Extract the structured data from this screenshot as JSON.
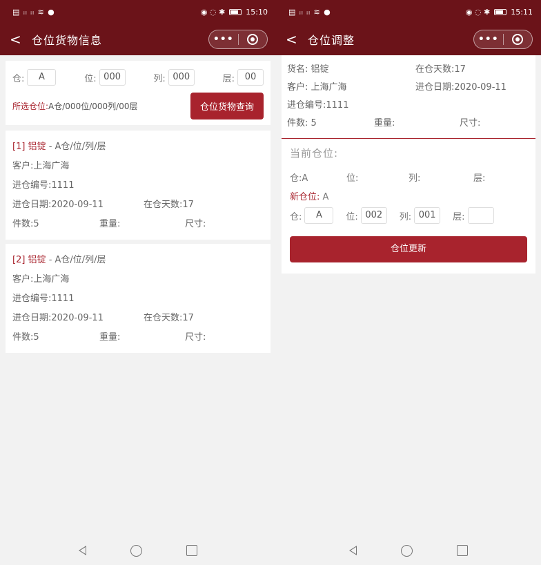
{
  "left": {
    "status": {
      "signal": "▤ ᵢₗ ᵢₗ ≋ ●",
      "right_icons": "◉ ◌ ✱",
      "battery": "78",
      "time": "15:10"
    },
    "nav": {
      "back": "<",
      "title": "仓位货物信息",
      "more": "•••"
    },
    "search": {
      "cang_label": "仓:",
      "cang_value": "A",
      "wei_label": "位:",
      "wei_value": "000",
      "lie_label": "列:",
      "lie_value": "000",
      "ceng_label": "层:",
      "ceng_value": "00"
    },
    "selected": {
      "label": "所选仓位:",
      "value": "A仓/000位/000列/00层"
    },
    "query_button": "仓位货物查询",
    "cards": [
      {
        "index": "[1] 铝锭",
        "loc": " - A仓/位/列/层",
        "customer": "客户:上海广海",
        "entry_no": "进仓编号:1111",
        "entry_date": "进仓日期:2020-09-11",
        "days": "在仓天数:17",
        "count": "件数:5",
        "weight": "重量:",
        "size": "尺寸:"
      },
      {
        "index": "[2] 铝锭",
        "loc": " - A仓/位/列/层",
        "customer": "客户:上海广海",
        "entry_no": "进仓编号:1111",
        "entry_date": "进仓日期:2020-09-11",
        "days": "在仓天数:17",
        "count": "件数:5",
        "weight": "重量:",
        "size": "尺寸:"
      }
    ]
  },
  "right": {
    "status": {
      "signal": "▤ ᵢₗ ᵢₗ ≋ ●",
      "right_icons": "◉ ◌ ✱",
      "battery": "78",
      "time": "15:11"
    },
    "nav": {
      "back": "<",
      "title": "仓位调整",
      "more": "•••"
    },
    "info": {
      "goods": "货名: 铝锭",
      "days": "在仓天数:17",
      "customer": "客户: 上海广海",
      "entry_date": "进仓日期:2020-09-11",
      "entry_no": "进仓编号:1111",
      "count": "件数: 5",
      "weight": "重量:",
      "size": "尺寸:"
    },
    "current": {
      "title": "当前仓位:",
      "cang": "仓:A",
      "wei": "位:",
      "lie": "列:",
      "ceng": "层:"
    },
    "new_loc": {
      "label": "新仓位:",
      "label_value": "A",
      "cang_label": "仓:",
      "cang_value": "A",
      "wei_label": "位:",
      "wei_value": "002",
      "lie_label": "列:",
      "lie_value": "001",
      "ceng_label": "层:",
      "ceng_value": ""
    },
    "update_button": "仓位更新"
  },
  "colors": {
    "header": "#6b1319",
    "accent": "#a8232d",
    "background": "#f2f2f2"
  }
}
